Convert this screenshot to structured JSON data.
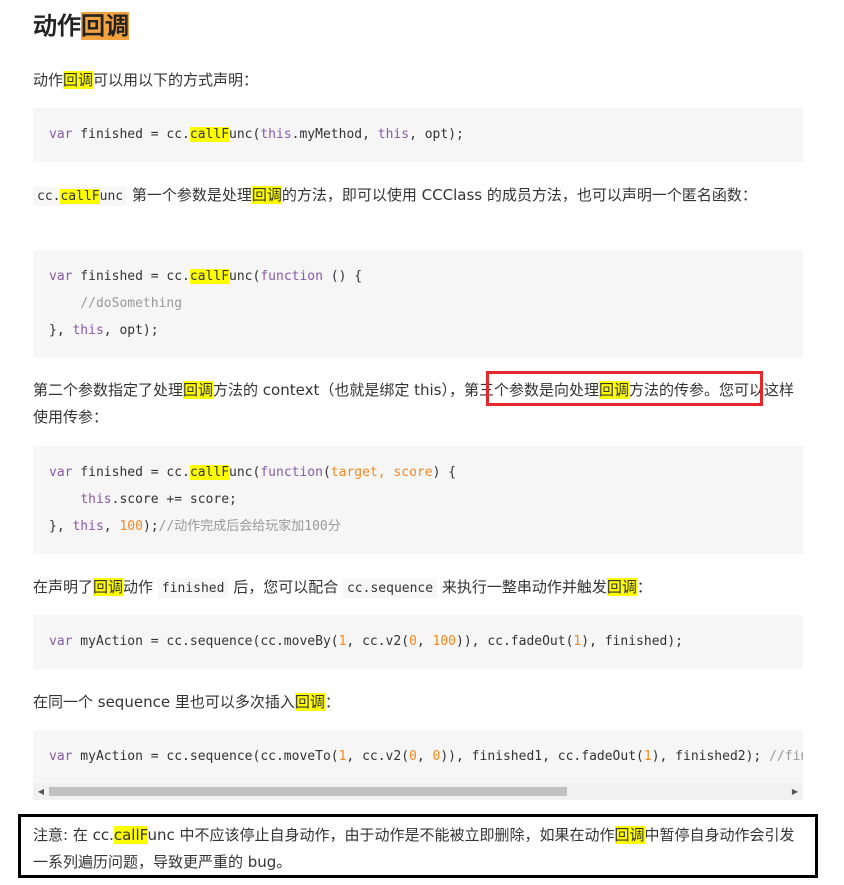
{
  "heading": {
    "prefix": "动作",
    "highlight": "回调"
  },
  "p1": {
    "a": "动作",
    "b": "回调",
    "c": "可以用以下的方式声明："
  },
  "code1": {
    "l1": {
      "kw1": "var",
      "t1": " finished = cc.",
      "hl": "callF",
      "t2": "unc(",
      "kw2": "this",
      "t3": ".myMethod, ",
      "kw3": "this",
      "t4": ", opt);"
    }
  },
  "p2": {
    "code_a": "cc.",
    "code_hl": "callF",
    "code_b": "unc",
    "t1": " 第一个参数是处理",
    "hl": "回调",
    "t2": "的方法，即可以使用 CCClass 的成员方法，也可以声明一个匿名函数："
  },
  "code2": {
    "l1": {
      "kw1": "var",
      "t1": " finished = cc.",
      "hl": "callF",
      "t2": "unc(",
      "kw2": "function",
      "t3": " () {"
    },
    "l2": {
      "indent": "    ",
      "cmt": "//doSomething"
    },
    "l3": {
      "t1": "}, ",
      "kw": "this",
      "t2": ", opt);"
    }
  },
  "p3": {
    "t1": "第二个参数指定了处理",
    "hl1": "回调",
    "t2": "方法的 context（也就是绑定 this），",
    "t3": "第三个参数是向处理",
    "hl2": "回调",
    "t4": "方法的传参。",
    "t5": "您可以这样使用传参："
  },
  "code3": {
    "l1": {
      "kw1": "var",
      "t1": " finished = cc.",
      "hl": "callF",
      "t2": "unc(",
      "kw2": "function",
      "t3": "(",
      "p1": "target",
      "t4": ", ",
      "p2": "score",
      "t5": ") {"
    },
    "l2": {
      "indent": "    ",
      "kw": "this",
      "t1": ".score += score;"
    },
    "l3": {
      "t1": "}, ",
      "kw": "this",
      "t2": ", ",
      "num": "100",
      "t3": ");",
      "cmt": "//动作完成后会给玩家加100分"
    }
  },
  "p4": {
    "t1": "在声明了",
    "hl1": "回调",
    "t2": "动作 ",
    "code1": "finished",
    "t3": " 后，您可以配合 ",
    "code2": "cc.sequence",
    "t4": " 来执行一整串动作并触发",
    "hl2": "回调",
    "t5": "："
  },
  "code4": {
    "l1": {
      "kw": "var",
      "t1": " myAction = cc.sequence(cc.moveBy(",
      "n1": "1",
      "t2": ", cc.v2(",
      "n2": "0",
      "t3": ", ",
      "n3": "100",
      "t4": ")), cc.fadeOut(",
      "n4": "1",
      "t5": "), finished);"
    }
  },
  "p5": {
    "t1": "在同一个 sequence 里也可以多次插入",
    "hl": "回调",
    "t2": "："
  },
  "code5": {
    "l1": {
      "kw": "var",
      "t1": " myAction = cc.sequence(cc.moveTo(",
      "n1": "1",
      "t2": ", cc.v2(",
      "n2": "0",
      "t3": ", ",
      "n3": "0",
      "t4": ")), finished1, cc.fadeOut(",
      "n4": "1",
      "t5": "), finished2); ",
      "cmt": "//fini"
    }
  },
  "scrollbar": {
    "left_arrow": "◀",
    "right_arrow": "▶"
  },
  "note": {
    "t1": "注意: 在 cc.",
    "hl1": "callF",
    "t2": "unc 中不应该停止自身动作，由于动作是不能被立即删除，如果在动作",
    "hl2": "回调",
    "t3": "中暂停自身动作会引发一系列遍历问题，导致更严重的 bug。"
  },
  "colors": {
    "highlight": "#ffff00",
    "heading_highlight": "#f3a23f",
    "red_box": "#e8272c",
    "code_bg": "#f6f6f6"
  }
}
